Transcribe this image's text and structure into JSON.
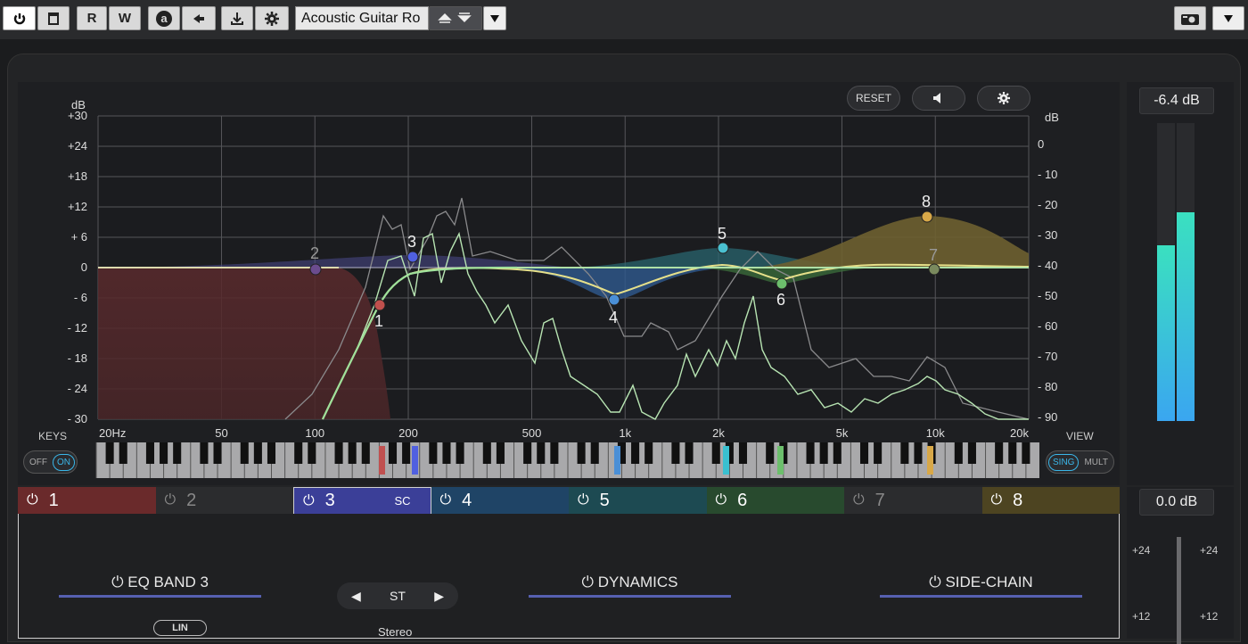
{
  "toolbar": {
    "power_icon": "power-icon",
    "b2_icon": "window-icon",
    "read_label": "R",
    "write_label": "W",
    "a_label": "a",
    "preset_name": "Acoustic Guitar Ro",
    "snapshot_icon": "camera-icon"
  },
  "graph": {
    "reset_label": "RESET",
    "left_axis_title": "dB",
    "right_axis_title": "dB",
    "left_ticks": [
      "+30",
      "+24",
      "+18",
      "+12",
      "+ 6",
      "0",
      "- 6",
      "- 12",
      "- 18",
      "- 24",
      "- 30"
    ],
    "right_ticks": [
      "0",
      "- 10",
      "- 20",
      "- 30",
      "- 40",
      "- 50",
      "- 60",
      "- 70",
      "- 80",
      "- 90"
    ],
    "freq_ticks": [
      "20Hz",
      "50",
      "100",
      "200",
      "500",
      "1k",
      "2k",
      "5k",
      "10k",
      "20k"
    ],
    "keys_label": "KEYS",
    "keys_off": "OFF",
    "keys_on": "ON",
    "view_label": "VIEW",
    "view_sing": "SING",
    "view_mult": "MULT",
    "band_labels": [
      "1",
      "2",
      "3",
      "4",
      "5",
      "6",
      "7",
      "8"
    ]
  },
  "meters": {
    "top_readout": "-6.4 dB",
    "bottom_readout": "0.0 dB",
    "left_level": 0.59,
    "right_level": 0.7,
    "scale_left": [
      "+24",
      "+12"
    ],
    "scale_right": [
      "+24",
      "+12"
    ]
  },
  "bands": [
    {
      "num": "1",
      "color": "#6a2a2b",
      "active": true
    },
    {
      "num": "2",
      "color": "#2b2c2e",
      "active": false
    },
    {
      "num": "3",
      "color": "#3b3f98",
      "active": true,
      "extra": "SC"
    },
    {
      "num": "4",
      "color": "#1f4466",
      "active": true
    },
    {
      "num": "5",
      "color": "#1d4a52",
      "active": true
    },
    {
      "num": "6",
      "color": "#284a2e",
      "active": true
    },
    {
      "num": "7",
      "color": "#2b2c2e",
      "active": false
    },
    {
      "num": "8",
      "color": "#4d4421",
      "active": true
    }
  ],
  "bottom": {
    "eq_band_title": "EQ BAND 3",
    "lin_label": "LIN",
    "channel_mode": "ST",
    "channel_sub": "Stereo",
    "dynamics_title": "DYNAMICS",
    "sidechain_title": "SIDE-CHAIN"
  }
}
